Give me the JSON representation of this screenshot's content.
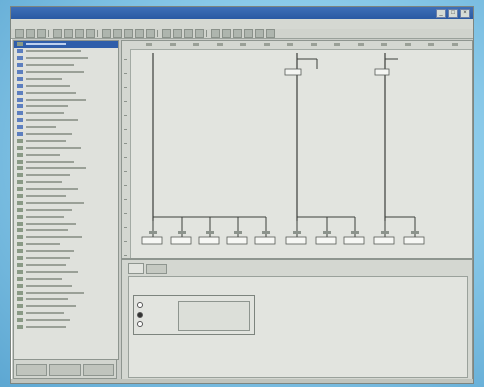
{
  "window": {
    "title": "",
    "controls": [
      "_",
      "□",
      "×"
    ]
  },
  "menubar": {
    "items": []
  },
  "sidebar": {
    "item_count": 42,
    "selected_index": 0,
    "tabs": []
  },
  "diagram": {
    "blocks": []
  },
  "bottom_panel": {
    "tabs": [],
    "group_title": "",
    "options": []
  },
  "colors": {
    "title_bar": "#2a5aa3",
    "selection": "#2f5eaa",
    "panel_bg": "#e2e4df",
    "desktop": "#8ccbea"
  }
}
